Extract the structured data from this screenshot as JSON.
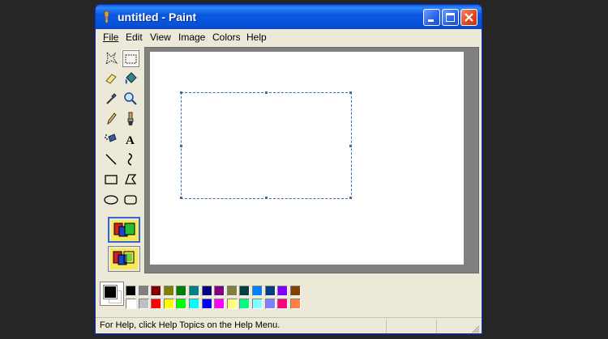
{
  "window": {
    "title": "untitled - Paint",
    "colors": {
      "titlebar": "#0652d9",
      "close_button": "#e0451d",
      "frame": "#ece9d8",
      "canvas_bg": "#808080"
    }
  },
  "title_buttons": [
    "minimize-icon",
    "maximize-icon",
    "close-icon"
  ],
  "menu": [
    {
      "label": "File"
    },
    {
      "label": "Edit"
    },
    {
      "label": "View"
    },
    {
      "label": "Image"
    },
    {
      "label": "Colors"
    },
    {
      "label": "Help"
    }
  ],
  "tools": [
    {
      "name": "free-form-select",
      "icon": "free-form-select-icon",
      "selected": false
    },
    {
      "name": "select",
      "icon": "rect-select-icon",
      "selected": true
    },
    {
      "name": "eraser",
      "icon": "eraser-icon",
      "selected": false
    },
    {
      "name": "fill",
      "icon": "fill-bucket-icon",
      "selected": false
    },
    {
      "name": "pick-color",
      "icon": "eyedropper-icon",
      "selected": false
    },
    {
      "name": "magnifier",
      "icon": "magnifier-icon",
      "selected": false
    },
    {
      "name": "pencil",
      "icon": "pencil-icon",
      "selected": false
    },
    {
      "name": "brush",
      "icon": "brush-icon",
      "selected": false
    },
    {
      "name": "airbrush",
      "icon": "airbrush-icon",
      "selected": false
    },
    {
      "name": "text",
      "icon": "text-icon",
      "selected": false
    },
    {
      "name": "line",
      "icon": "line-icon",
      "selected": false
    },
    {
      "name": "curve",
      "icon": "curve-icon",
      "selected": false
    },
    {
      "name": "rectangle",
      "icon": "rectangle-icon",
      "selected": false
    },
    {
      "name": "polygon",
      "icon": "polygon-icon",
      "selected": false
    },
    {
      "name": "ellipse",
      "icon": "ellipse-icon",
      "selected": false
    },
    {
      "name": "rounded-rectangle",
      "icon": "rounded-rectangle-icon",
      "selected": false
    }
  ],
  "tool_options": [
    {
      "name": "opaque-selection",
      "icon": "opaque-selection-icon",
      "active": true
    },
    {
      "name": "transparent-selection",
      "icon": "transparent-selection-icon",
      "active": false
    }
  ],
  "palette": {
    "foreground": "#000000",
    "background": "#ffffff",
    "row1": [
      "#000000",
      "#808080",
      "#800000",
      "#808000",
      "#008000",
      "#008080",
      "#000080",
      "#800080",
      "#808040",
      "#004040",
      "#0080ff",
      "#004080",
      "#8000ff",
      "#804000"
    ],
    "row2": [
      "#ffffff",
      "#c0c0c0",
      "#ff0000",
      "#ffff00",
      "#00ff00",
      "#00ffff",
      "#0000ff",
      "#ff00ff",
      "#ffff80",
      "#00ff80",
      "#80ffff",
      "#8080ff",
      "#ff0080",
      "#ff8040"
    ]
  },
  "status": {
    "text": "For Help, click Help Topics on the Help Menu."
  }
}
